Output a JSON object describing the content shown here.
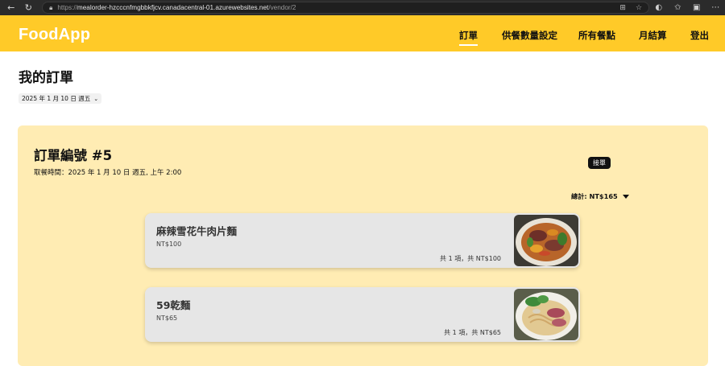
{
  "browser": {
    "url_prefix": "https://",
    "url_host": "mealorder-hzcccnfmgbbkfjcv.canadacentral-01.azurewebsites.net",
    "url_path": "/vendor/2"
  },
  "header": {
    "brand": "FoodApp",
    "nav": [
      "訂單",
      "供餐數量設定",
      "所有餐點",
      "月結算",
      "登出"
    ],
    "active_nav": "訂單",
    "color": "#ffca28"
  },
  "page": {
    "title": "我的訂單",
    "date_selected": "2025 年 1 月 10 日 週五"
  },
  "order": {
    "number_label": "訂單編號 #5",
    "pickup_time": "取餐時間：2025 年 1 月 10 日 週五, 上午 2:00",
    "accept_label": "接單",
    "total_label": "總計: NT$165",
    "card_color": "#ffecb3",
    "items": [
      {
        "name": "麻辣雪花牛肉片麵",
        "price": "NT$100",
        "qty_summary": "共 1 項，共 NT$100"
      },
      {
        "name": "59乾麵",
        "price": "NT$65",
        "qty_summary": "共 1 項，共 NT$65"
      }
    ]
  }
}
